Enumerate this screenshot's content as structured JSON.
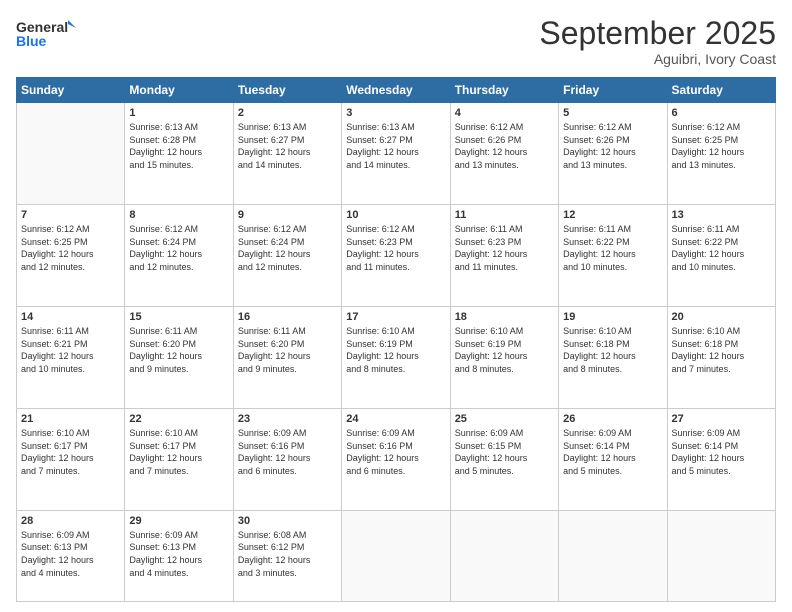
{
  "logo": {
    "line1": "General",
    "line2": "Blue"
  },
  "header": {
    "month": "September 2025",
    "location": "Aguibri, Ivory Coast"
  },
  "days_of_week": [
    "Sunday",
    "Monday",
    "Tuesday",
    "Wednesday",
    "Thursday",
    "Friday",
    "Saturday"
  ],
  "weeks": [
    [
      {
        "day": "",
        "info": ""
      },
      {
        "day": "1",
        "info": "Sunrise: 6:13 AM\nSunset: 6:28 PM\nDaylight: 12 hours\nand 15 minutes."
      },
      {
        "day": "2",
        "info": "Sunrise: 6:13 AM\nSunset: 6:27 PM\nDaylight: 12 hours\nand 14 minutes."
      },
      {
        "day": "3",
        "info": "Sunrise: 6:13 AM\nSunset: 6:27 PM\nDaylight: 12 hours\nand 14 minutes."
      },
      {
        "day": "4",
        "info": "Sunrise: 6:12 AM\nSunset: 6:26 PM\nDaylight: 12 hours\nand 13 minutes."
      },
      {
        "day": "5",
        "info": "Sunrise: 6:12 AM\nSunset: 6:26 PM\nDaylight: 12 hours\nand 13 minutes."
      },
      {
        "day": "6",
        "info": "Sunrise: 6:12 AM\nSunset: 6:25 PM\nDaylight: 12 hours\nand 13 minutes."
      }
    ],
    [
      {
        "day": "7",
        "info": "Sunrise: 6:12 AM\nSunset: 6:25 PM\nDaylight: 12 hours\nand 12 minutes."
      },
      {
        "day": "8",
        "info": "Sunrise: 6:12 AM\nSunset: 6:24 PM\nDaylight: 12 hours\nand 12 minutes."
      },
      {
        "day": "9",
        "info": "Sunrise: 6:12 AM\nSunset: 6:24 PM\nDaylight: 12 hours\nand 12 minutes."
      },
      {
        "day": "10",
        "info": "Sunrise: 6:12 AM\nSunset: 6:23 PM\nDaylight: 12 hours\nand 11 minutes."
      },
      {
        "day": "11",
        "info": "Sunrise: 6:11 AM\nSunset: 6:23 PM\nDaylight: 12 hours\nand 11 minutes."
      },
      {
        "day": "12",
        "info": "Sunrise: 6:11 AM\nSunset: 6:22 PM\nDaylight: 12 hours\nand 10 minutes."
      },
      {
        "day": "13",
        "info": "Sunrise: 6:11 AM\nSunset: 6:22 PM\nDaylight: 12 hours\nand 10 minutes."
      }
    ],
    [
      {
        "day": "14",
        "info": "Sunrise: 6:11 AM\nSunset: 6:21 PM\nDaylight: 12 hours\nand 10 minutes."
      },
      {
        "day": "15",
        "info": "Sunrise: 6:11 AM\nSunset: 6:20 PM\nDaylight: 12 hours\nand 9 minutes."
      },
      {
        "day": "16",
        "info": "Sunrise: 6:11 AM\nSunset: 6:20 PM\nDaylight: 12 hours\nand 9 minutes."
      },
      {
        "day": "17",
        "info": "Sunrise: 6:10 AM\nSunset: 6:19 PM\nDaylight: 12 hours\nand 8 minutes."
      },
      {
        "day": "18",
        "info": "Sunrise: 6:10 AM\nSunset: 6:19 PM\nDaylight: 12 hours\nand 8 minutes."
      },
      {
        "day": "19",
        "info": "Sunrise: 6:10 AM\nSunset: 6:18 PM\nDaylight: 12 hours\nand 8 minutes."
      },
      {
        "day": "20",
        "info": "Sunrise: 6:10 AM\nSunset: 6:18 PM\nDaylight: 12 hours\nand 7 minutes."
      }
    ],
    [
      {
        "day": "21",
        "info": "Sunrise: 6:10 AM\nSunset: 6:17 PM\nDaylight: 12 hours\nand 7 minutes."
      },
      {
        "day": "22",
        "info": "Sunrise: 6:10 AM\nSunset: 6:17 PM\nDaylight: 12 hours\nand 7 minutes."
      },
      {
        "day": "23",
        "info": "Sunrise: 6:09 AM\nSunset: 6:16 PM\nDaylight: 12 hours\nand 6 minutes."
      },
      {
        "day": "24",
        "info": "Sunrise: 6:09 AM\nSunset: 6:16 PM\nDaylight: 12 hours\nand 6 minutes."
      },
      {
        "day": "25",
        "info": "Sunrise: 6:09 AM\nSunset: 6:15 PM\nDaylight: 12 hours\nand 5 minutes."
      },
      {
        "day": "26",
        "info": "Sunrise: 6:09 AM\nSunset: 6:14 PM\nDaylight: 12 hours\nand 5 minutes."
      },
      {
        "day": "27",
        "info": "Sunrise: 6:09 AM\nSunset: 6:14 PM\nDaylight: 12 hours\nand 5 minutes."
      }
    ],
    [
      {
        "day": "28",
        "info": "Sunrise: 6:09 AM\nSunset: 6:13 PM\nDaylight: 12 hours\nand 4 minutes."
      },
      {
        "day": "29",
        "info": "Sunrise: 6:09 AM\nSunset: 6:13 PM\nDaylight: 12 hours\nand 4 minutes."
      },
      {
        "day": "30",
        "info": "Sunrise: 6:08 AM\nSunset: 6:12 PM\nDaylight: 12 hours\nand 3 minutes."
      },
      {
        "day": "",
        "info": ""
      },
      {
        "day": "",
        "info": ""
      },
      {
        "day": "",
        "info": ""
      },
      {
        "day": "",
        "info": ""
      }
    ]
  ]
}
